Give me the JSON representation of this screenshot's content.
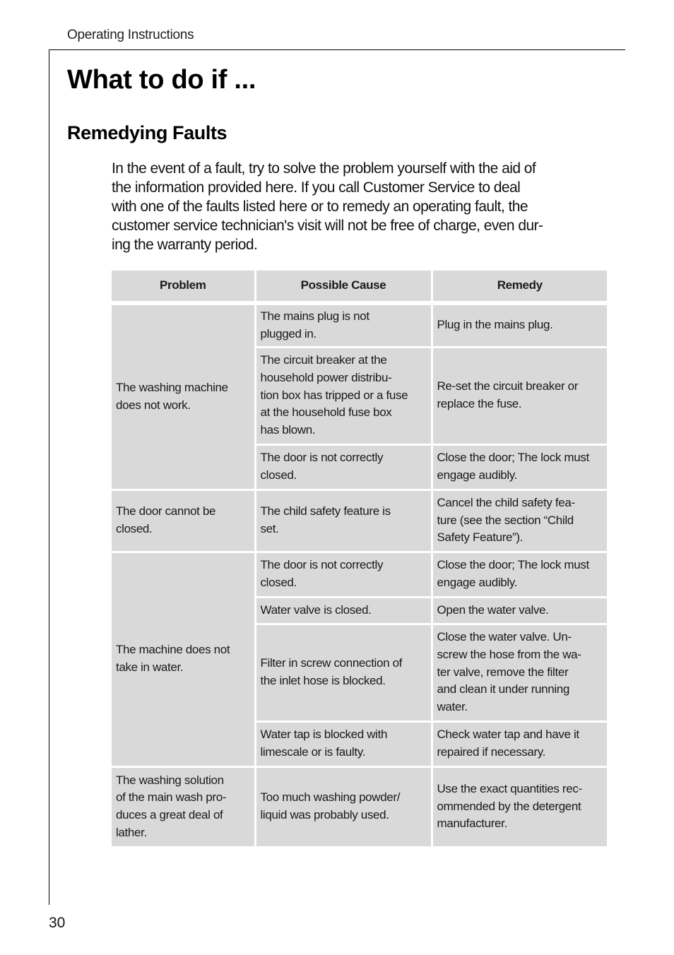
{
  "header": {
    "running_title": "Operating Instructions"
  },
  "page": {
    "title": "What to do if ...",
    "section_title": "Remedying Faults",
    "intro_lines": [
      "In the event of a fault, try to solve the problem yourself with the aid of",
      "the information provided here. If you call Customer Service to deal",
      "with one of the faults listed here or to remedy an operating fault, the",
      "customer service technician's visit will not be free of charge, even dur-",
      "ing the warranty period."
    ],
    "page_number": "30"
  },
  "table": {
    "columns": [
      "Problem",
      "Possible Cause",
      "Remedy"
    ],
    "groups": [
      {
        "problem": [
          "The washing machine",
          "does not work."
        ],
        "rows": [
          {
            "cause": [
              "The mains plug is not",
              "plugged in."
            ],
            "remedy": [
              "Plug in the mains plug."
            ]
          },
          {
            "cause": [
              "The circuit breaker at the",
              "household power distribu-",
              "tion box has tripped or a fuse",
              "at the household fuse box",
              "has blown."
            ],
            "remedy": [
              "Re-set the circuit breaker or",
              "replace the fuse."
            ]
          },
          {
            "cause": [
              "The door is not correctly",
              "closed."
            ],
            "remedy": [
              "Close the door; The lock must",
              "engage audibly."
            ]
          }
        ]
      },
      {
        "problem": [
          "The door cannot be",
          "closed."
        ],
        "rows": [
          {
            "cause": [
              "The child safety feature is",
              "set."
            ],
            "remedy": [
              "Cancel the child safety fea-",
              "ture (see the section “Child",
              "Safety Feature”)."
            ]
          }
        ]
      },
      {
        "problem": [
          "The machine does not",
          "take in water."
        ],
        "rows": [
          {
            "cause": [
              "The door is not correctly",
              "closed."
            ],
            "remedy": [
              "Close the door; The lock must",
              "engage audibly."
            ]
          },
          {
            "cause": [
              "Water valve is closed."
            ],
            "remedy": [
              "Open the water valve."
            ]
          },
          {
            "cause": [
              "Filter in screw connection of",
              "the inlet hose is blocked."
            ],
            "remedy": [
              "Close the water valve. Un-",
              "screw the hose from the wa-",
              "ter valve, remove the filter",
              "and clean it under running",
              "water."
            ]
          },
          {
            "cause": [
              "Water tap is blocked with",
              "limescale or is faulty."
            ],
            "remedy": [
              "Check water tap and have it",
              "repaired if necessary."
            ]
          }
        ]
      },
      {
        "problem": [
          "The washing solution",
          "of the main wash pro-",
          "duces a great deal of",
          "lather."
        ],
        "rows": [
          {
            "cause": [
              "Too much washing powder/",
              "liquid was probably used."
            ],
            "remedy": [
              "Use the exact quantities rec-",
              "ommended by the detergent",
              "manufacturer."
            ]
          }
        ]
      }
    ]
  },
  "colors": {
    "cell_background": "#d9d9d9",
    "rule": "#000000"
  }
}
